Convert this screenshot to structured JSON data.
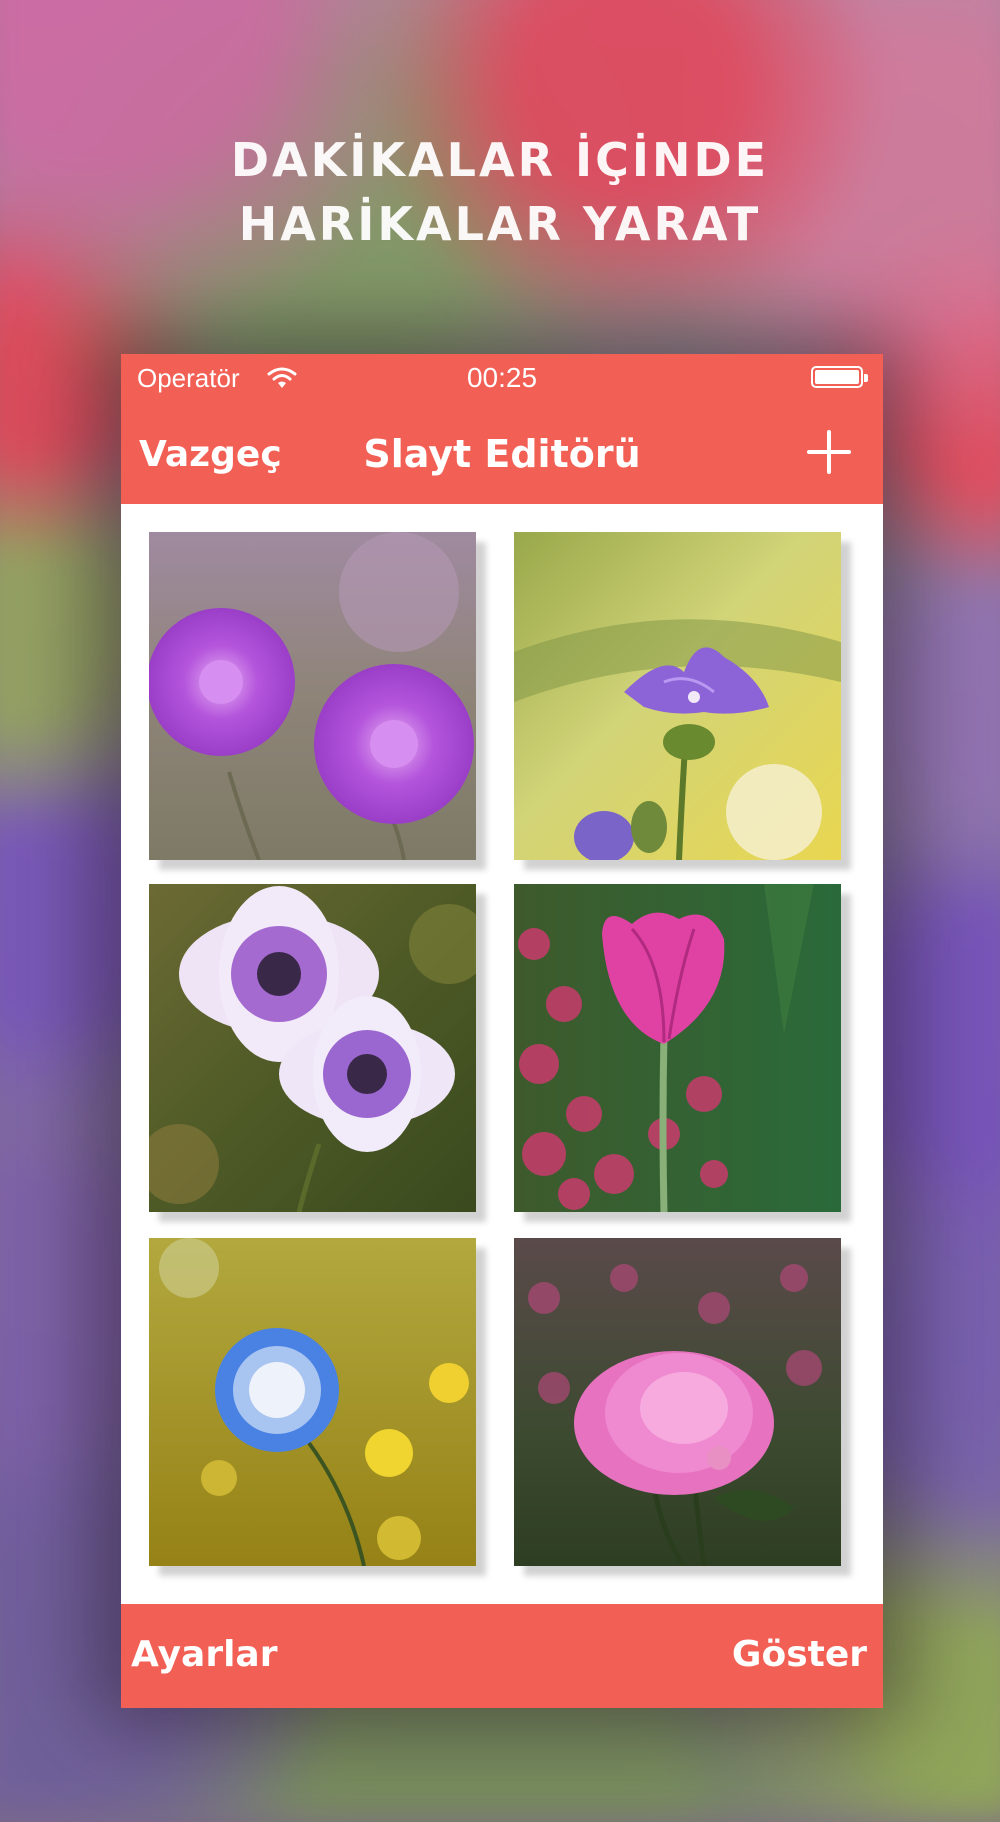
{
  "promo": {
    "line1": "DAKİKALAR İÇİNDE",
    "line2": "HARİKALAR YARAT"
  },
  "status_bar": {
    "carrier": "Operatör",
    "time": "00:25"
  },
  "nav": {
    "cancel_label": "Vazgeç",
    "title": "Slayt Editörü",
    "add_icon": "plus-icon"
  },
  "photos": [
    {
      "subject": "purple scabiosa pair"
    },
    {
      "subject": "purple bellflower"
    },
    {
      "subject": "white-purple anemones"
    },
    {
      "subject": "pink tulip"
    },
    {
      "subject": "blue cornflower"
    },
    {
      "subject": "pink peony"
    }
  ],
  "toolbar": {
    "left_label": "Ayarlar",
    "right_label": "Göster"
  },
  "colors": {
    "accent": "#f25f54",
    "text_on_accent": "#ffffff"
  }
}
